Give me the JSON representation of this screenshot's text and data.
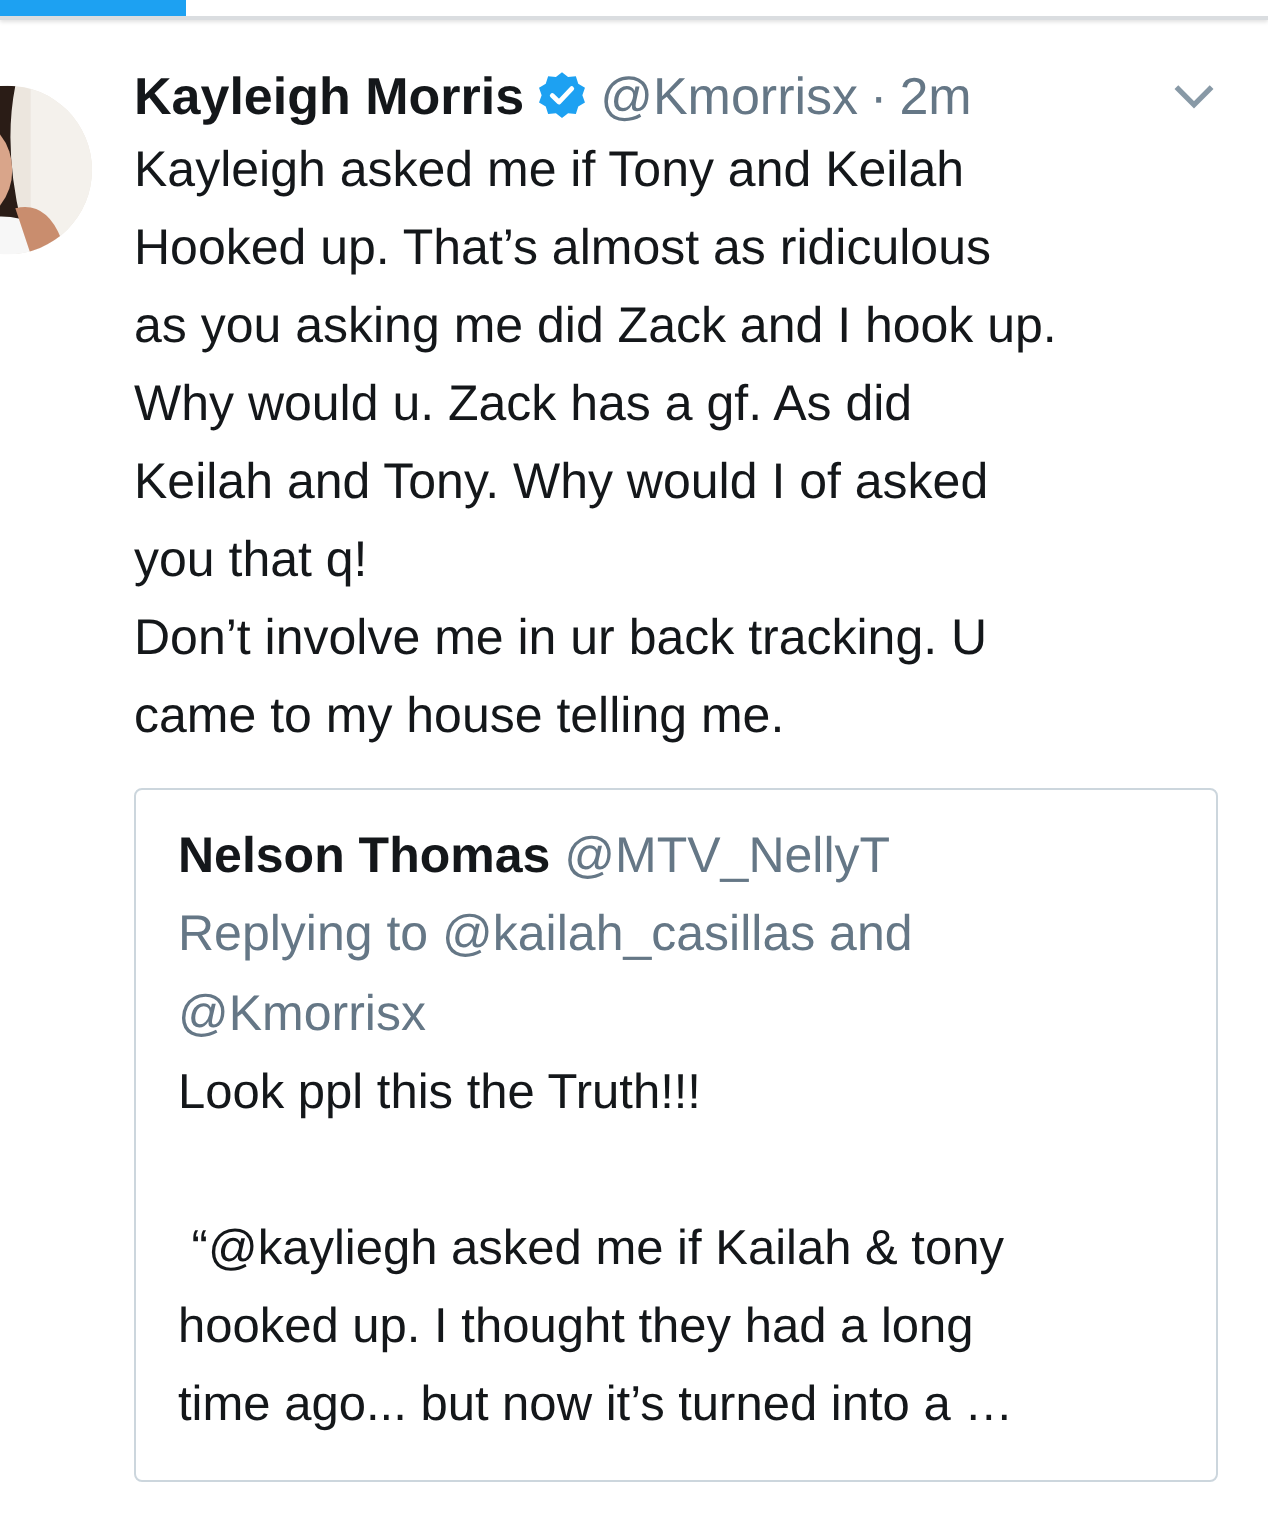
{
  "progress": {
    "level": 0.147
  },
  "tweet": {
    "name": "Kayleigh Morris",
    "verified": true,
    "handle": "@Kmorrisx",
    "separator": "·",
    "time": "2m",
    "text": "Kayleigh asked me if Tony and Keilah\nHooked up. That’s almost as ridiculous\nas you asking me did Zack and I hook up.\nWhy would u. Zack has a gf. As did\nKeilah and Tony. Why would I of asked\nyou that q!\nDon’t involve me in ur back tracking. U\ncame to my house telling me.",
    "quote": {
      "name": "Nelson Thomas",
      "handle": "@MTV_NellyT",
      "replying": "Replying to @kailah_casillas and\n@Kmorrisx",
      "text": "Look ppl this the Truth!!!\n\n “@kayliegh asked me if Kailah & tony\nhooked up. I thought they had a long\ntime ago... but now it’s turned into a …"
    }
  }
}
